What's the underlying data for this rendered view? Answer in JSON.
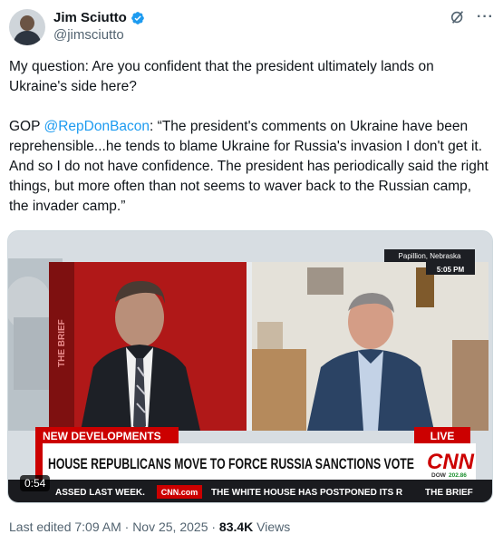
{
  "author": {
    "display_name": "Jim Sciutto",
    "handle": "@jimsciutto"
  },
  "tweet": {
    "paragraph1": "My question: Are you confident that the president ultimately lands on Ukraine's side here?",
    "paragraph2_prefix": "GOP ",
    "mention": "@RepDonBacon",
    "paragraph2_rest": ": “The president's comments on Ukraine have been reprehensible...he tends to blame Ukraine for Russia's invasion I don't get it. And so I do not have confidence. The president has periodically said the right things, but more often than not seems to waver back to the Russian camp, the invader camp.”"
  },
  "video": {
    "location": "Papillion, Nebraska",
    "time": "5:05 PM",
    "banner_tag": "NEW DEVELOPMENTS",
    "live_label": "LIVE",
    "headline": "HOUSE REPUBLICANS MOVE TO FORCE RUSSIA SANCTIONS VOTE",
    "network_logo": "CNN",
    "dow_label": "DOW",
    "dow_value": "202.86",
    "ticker_left": "ASSED LAST WEEK.",
    "ticker_site": "CNN.com",
    "ticker_right": "THE WHITE HOUSE HAS POSTPONED ITS R",
    "ticker_show": "THE BRIEF",
    "wall_text": "THE BRIEF",
    "duration": "0:54"
  },
  "meta": {
    "edited": "Last edited 7:09 AM · Nov 25, 2025 · ",
    "views_count": "83.4K",
    "views_label": " Views"
  },
  "colors": {
    "verified_blue": "#1d9bf0",
    "cnn_red": "#cc0000",
    "text_secondary": "#536471"
  }
}
